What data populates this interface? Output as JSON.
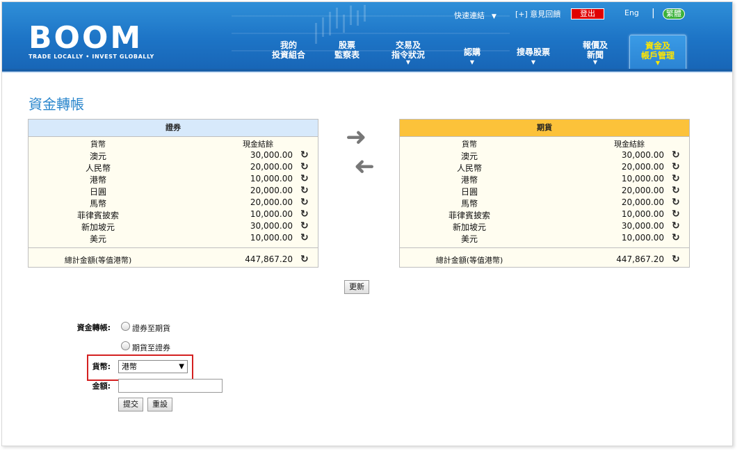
{
  "header": {
    "logo": "BOOM",
    "tagline": "TRADE LOCALLY • INVEST GLOBALLY",
    "quick_links": "快速連結",
    "feedback": "[+] 意見回饋",
    "logout": "登出",
    "lang_en": "Eng",
    "lang_cur": "繁體"
  },
  "nav": [
    {
      "line1": "我的",
      "line2": "投資組合",
      "arrow": ""
    },
    {
      "line1": "股票",
      "line2": "監察表",
      "arrow": ""
    },
    {
      "line1": "交易及",
      "line2": "指令狀況",
      "arrow": "▼"
    },
    {
      "line1": "認購",
      "line2": "",
      "arrow": "▼"
    },
    {
      "line1": "搜尋股票",
      "line2": "",
      "arrow": "▼"
    },
    {
      "line1": "報價及",
      "line2": "新聞",
      "arrow": "▼"
    },
    {
      "line1": "資金及",
      "line2": "帳戶管理",
      "arrow": "▼"
    }
  ],
  "page_title": "資金轉帳",
  "left_panel": {
    "title": "證券",
    "col_currency": "貨幣",
    "col_cash": "現金結餘",
    "rows": [
      {
        "currency": "澳元",
        "amount": "30,000.00"
      },
      {
        "currency": "人民幣",
        "amount": "20,000.00"
      },
      {
        "currency": "港幣",
        "amount": "10,000.00"
      },
      {
        "currency": "日圓",
        "amount": "20,000.00"
      },
      {
        "currency": "馬幣",
        "amount": "20,000.00"
      },
      {
        "currency": "菲律賓披索",
        "amount": "10,000.00"
      },
      {
        "currency": "新加坡元",
        "amount": "30,000.00"
      },
      {
        "currency": "美元",
        "amount": "10,000.00"
      }
    ],
    "total_label": "總計金額(等值港幣)",
    "total_amount": "447,867.20"
  },
  "right_panel": {
    "title": "期貨",
    "col_currency": "貨幣",
    "col_cash": "現金結餘",
    "rows": [
      {
        "currency": "澳元",
        "amount": "30,000.00"
      },
      {
        "currency": "人民幣",
        "amount": "20,000.00"
      },
      {
        "currency": "港幣",
        "amount": "10,000.00"
      },
      {
        "currency": "日圓",
        "amount": "20,000.00"
      },
      {
        "currency": "馬幣",
        "amount": "20,000.00"
      },
      {
        "currency": "菲律賓披索",
        "amount": "10,000.00"
      },
      {
        "currency": "新加坡元",
        "amount": "30,000.00"
      },
      {
        "currency": "美元",
        "amount": "10,000.00"
      }
    ],
    "total_label": "總計金額(等值港幣)",
    "total_amount": "447,867.20"
  },
  "update_button": "更新",
  "form": {
    "transfer_label": "資金轉帳:",
    "option1": "證券至期貨",
    "option2": "期貨至證券",
    "currency_label": "貨幣:",
    "currency_value": "港幣",
    "amount_label": "金額:",
    "submit": "提交",
    "reset": "重設"
  },
  "colors": {
    "header_blue": "#1d74c6",
    "title_blue": "#2a86cc",
    "securities_head": "#d7e9fb",
    "futures_head": "#fcc23a",
    "highlight_red": "#d42020"
  }
}
